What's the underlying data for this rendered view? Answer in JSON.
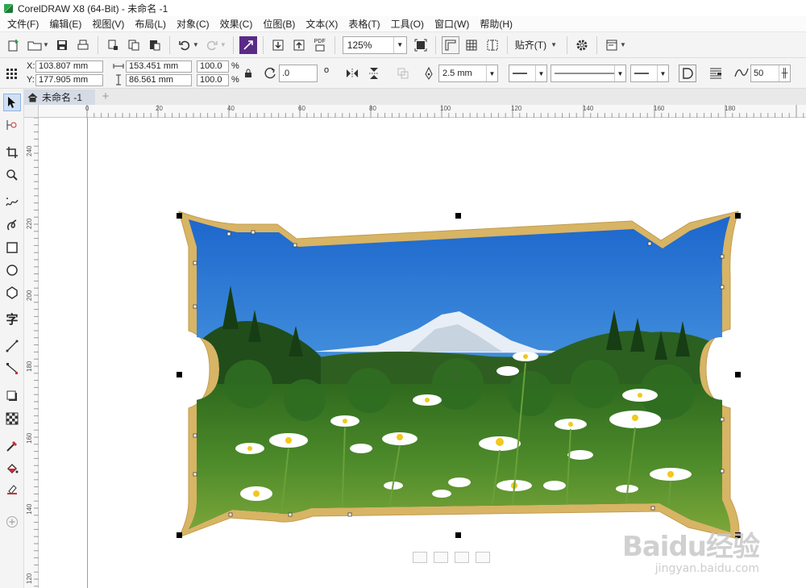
{
  "window": {
    "title": "CorelDRAW X8 (64-Bit) - 未命名 -1"
  },
  "menu": [
    "文件(F)",
    "编辑(E)",
    "视图(V)",
    "布局(L)",
    "对象(C)",
    "效果(C)",
    "位图(B)",
    "文本(X)",
    "表格(T)",
    "工具(O)",
    "窗口(W)",
    "帮助(H)"
  ],
  "toolbar": {
    "zoom": "125%",
    "pdf_label": "PDF",
    "snap_label": "贴齐(T)"
  },
  "propbar": {
    "x_label": "X:",
    "x_value": "103.807 mm",
    "y_label": "Y:",
    "y_value": "177.905 mm",
    "width_value": "153.451 mm",
    "height_value": "86.561 mm",
    "scale_w": "100.0",
    "scale_h": "100.0",
    "percent": "%",
    "rotation": ".0",
    "degree": "o",
    "outline_width": "2.5 mm",
    "smoothing": "50"
  },
  "doc": {
    "tab_label": "未命名 -1",
    "add_tab": "+"
  },
  "ruler": {
    "h_ticks": [
      "0",
      "20",
      "40",
      "60",
      "80",
      "100",
      "120",
      "140",
      "160",
      "180"
    ],
    "v_ticks": [
      "240",
      "220",
      "200",
      "180",
      "160",
      "140",
      "120"
    ]
  },
  "watermark": {
    "brand": "Baidu经验",
    "url": "jingyan.baidu.com"
  },
  "colors": {
    "frame": "#d9b66a",
    "sky_top": "#1f6fd0",
    "sky_bottom": "#8cc1ee",
    "handle": "#000000"
  }
}
